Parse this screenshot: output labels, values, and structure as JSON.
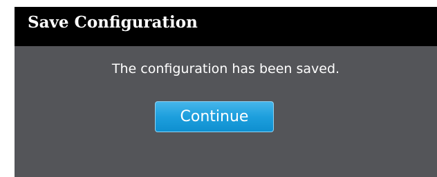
{
  "dialog": {
    "title": "Save Configuration",
    "message": "The configuration has been saved.",
    "continue_label": "Continue"
  },
  "colors": {
    "header_background": "#000000",
    "body_background": "#545559",
    "button_background": "#1d9fdd",
    "text": "#ffffff"
  }
}
